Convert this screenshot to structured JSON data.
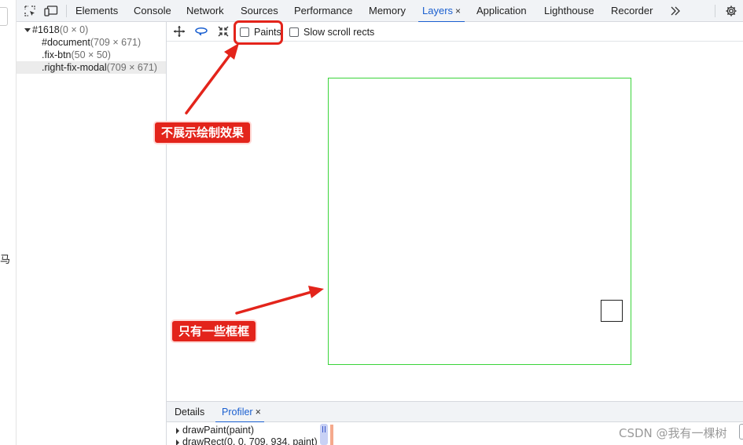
{
  "page_strip": {
    "partial_text": "​马"
  },
  "tabs": {
    "items": [
      {
        "label": "Elements"
      },
      {
        "label": "Console"
      },
      {
        "label": "Network"
      },
      {
        "label": "Sources"
      },
      {
        "label": "Performance"
      },
      {
        "label": "Memory"
      },
      {
        "label": "Layers",
        "active": true,
        "close": "×"
      },
      {
        "label": "Application"
      },
      {
        "label": "Lighthouse"
      },
      {
        "label": "Recorder"
      }
    ],
    "overflow_icon": "chevrons-right-icon",
    "settings_icon": "gear-icon"
  },
  "layer_tree": {
    "root": {
      "name": "#1618",
      "dims": "(0 × 0)"
    },
    "children": [
      {
        "name": "#document",
        "dims": "(709 × 671)"
      },
      {
        "name": ".fix-btn",
        "dims": "(50 × 50)"
      },
      {
        "name": ".right-fix-modal",
        "dims": "(709 × 671)"
      }
    ]
  },
  "layers_toolbar": {
    "paints_label": "Paints",
    "slow_scroll_label": "Slow scroll rects",
    "paints_checked": false,
    "slow_scroll_checked": false
  },
  "bottom_panel": {
    "tabs": [
      {
        "label": "Details"
      },
      {
        "label": "Profiler",
        "active": true,
        "close": "×"
      }
    ],
    "profiler_rows": [
      {
        "text": "drawPaint(paint)"
      },
      {
        "text": "drawRect(0, 0, 709, 934, paint)"
      }
    ]
  },
  "annotations": {
    "callout_paints": "不展示绘制效果",
    "callout_boxes": "只有一些框框",
    "color": "#e3241b"
  },
  "watermark": "CSDN @我有一棵树",
  "colors": {
    "accent": "#1a5fd0",
    "layer_border": "#3ad43a"
  }
}
